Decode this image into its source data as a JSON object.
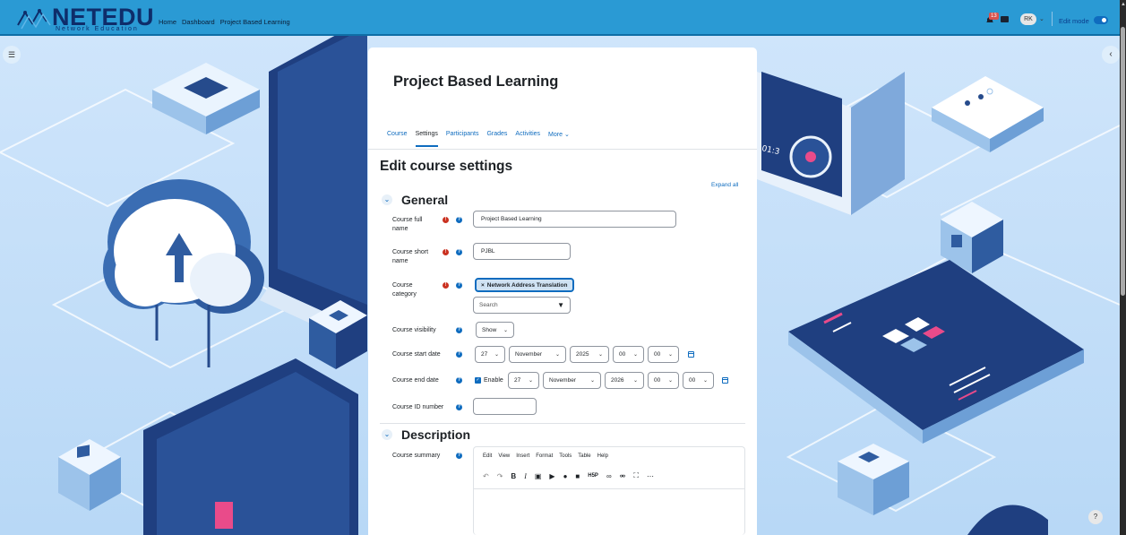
{
  "header": {
    "logo_text": "NETEDU",
    "logo_sub": "Network Education",
    "nav": [
      "Home",
      "Dashboard",
      "Project Based Learning"
    ],
    "notification_count": "13",
    "user_initials": "RK",
    "edit_mode_label": "Edit mode"
  },
  "course": {
    "title": "Project Based Learning",
    "tabs": [
      "Course",
      "Settings",
      "Participants",
      "Grades",
      "Activities",
      "More"
    ],
    "active_tab": "Settings"
  },
  "form": {
    "page_heading": "Edit course settings",
    "expand_all": "Expand all",
    "general_title": "General",
    "full_name_label": "Course full name",
    "full_name_value": "Project Based Learning",
    "short_name_label": "Course short name",
    "short_name_value": "PJBL",
    "category_label": "Course category",
    "category_selected": "Network Address Translation",
    "category_search_placeholder": "Search",
    "visibility_label": "Course visibility",
    "visibility_value": "Show",
    "start_date_label": "Course start date",
    "start_day": "27",
    "start_month": "November",
    "start_year": "2025",
    "start_hour": "00",
    "start_minute": "00",
    "end_date_label": "Course end date",
    "end_enable_label": "Enable",
    "end_day": "27",
    "end_month": "November",
    "end_year": "2026",
    "end_hour": "00",
    "end_minute": "00",
    "id_number_label": "Course ID number",
    "id_number_value": "",
    "description_title": "Description",
    "summary_label": "Course summary",
    "editor_menu": [
      "Edit",
      "View",
      "Insert",
      "Format",
      "Tools",
      "Table",
      "Help"
    ]
  },
  "help_label": "?",
  "colors": {
    "topbar": "#2a9ad4",
    "accent": "#0f6cbf",
    "required": "#ca3120"
  }
}
